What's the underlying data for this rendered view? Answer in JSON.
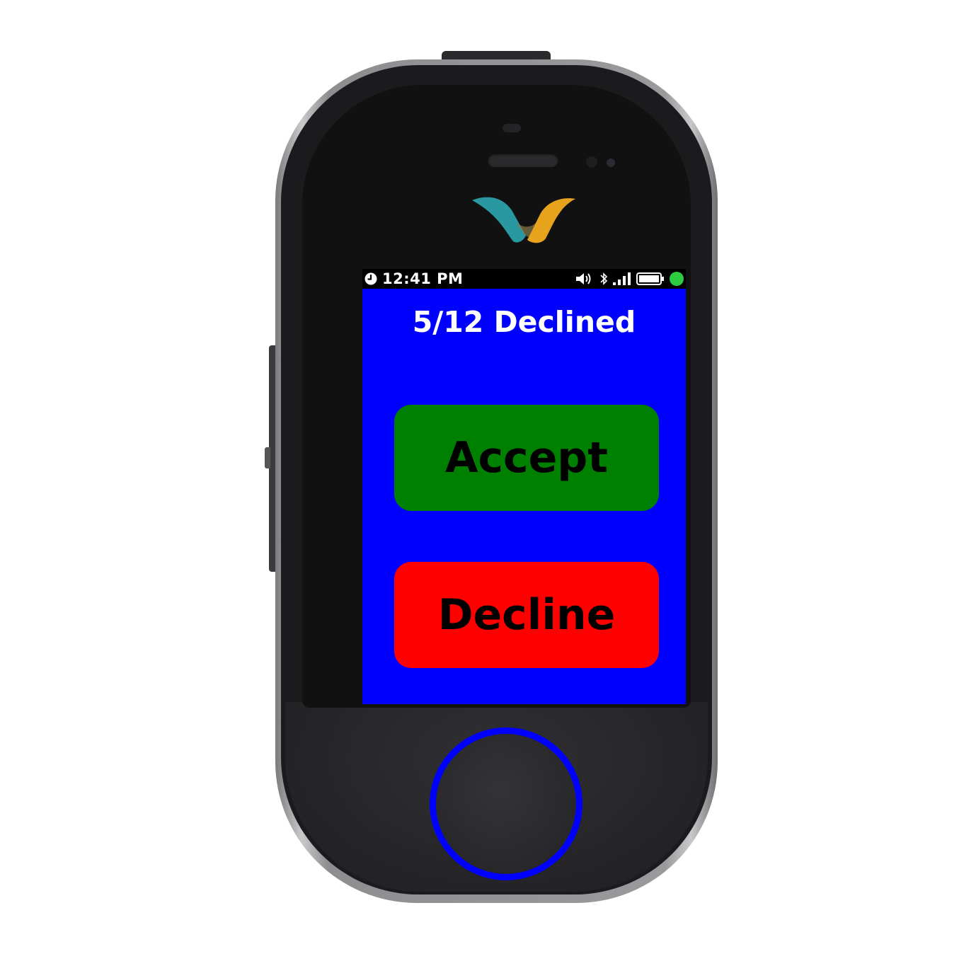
{
  "status_bar": {
    "time": "12:41 PM",
    "icons": [
      "clock-icon",
      "volume-icon",
      "bluetooth-icon",
      "signal-icon",
      "battery-icon",
      "status-dot-icon"
    ],
    "status_dot_color": "#2ecc40"
  },
  "screen": {
    "title": "5/12 Declined",
    "background_color": "#0000ff"
  },
  "buttons": {
    "accept_label": "Accept",
    "accept_color": "#008000",
    "decline_label": "Decline",
    "decline_color": "#ff0000"
  },
  "device": {
    "logo": "brand-v-logo",
    "home_ring_color": "#0000ff"
  }
}
